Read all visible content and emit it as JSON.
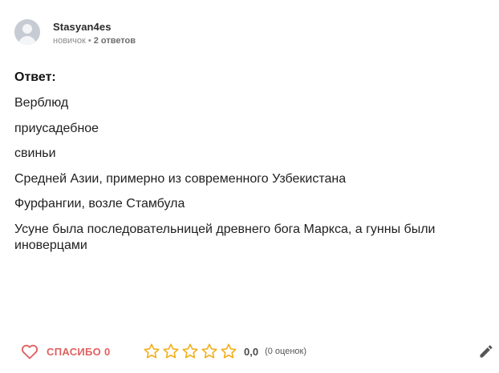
{
  "author": {
    "name": "Stasyan4es",
    "rank": "новичок",
    "separator": "•",
    "answers": "2 ответов"
  },
  "answer": {
    "label": "Ответ:",
    "lines": [
      "Верблюд",
      "приусадебное",
      "свиньи",
      "Средней Азии, примерно из современного Узбекистана",
      "Фурфангии, возле Стамбула",
      "Усуне была последовательницей древнего бога Маркса, а гунны были иноверцами"
    ]
  },
  "footer": {
    "thanks_label": "СПАСИБО 0",
    "rating_value": "0,0",
    "rating_count": "(0 оценок)",
    "stars_filled": 0,
    "stars_total": 5
  },
  "colors": {
    "accent": "#e0615f",
    "star": "#f2b01e",
    "muted": "#8c8c8c"
  },
  "icons": [
    "avatar-placeholder",
    "heart-icon",
    "star-icon",
    "pencil-icon"
  ]
}
